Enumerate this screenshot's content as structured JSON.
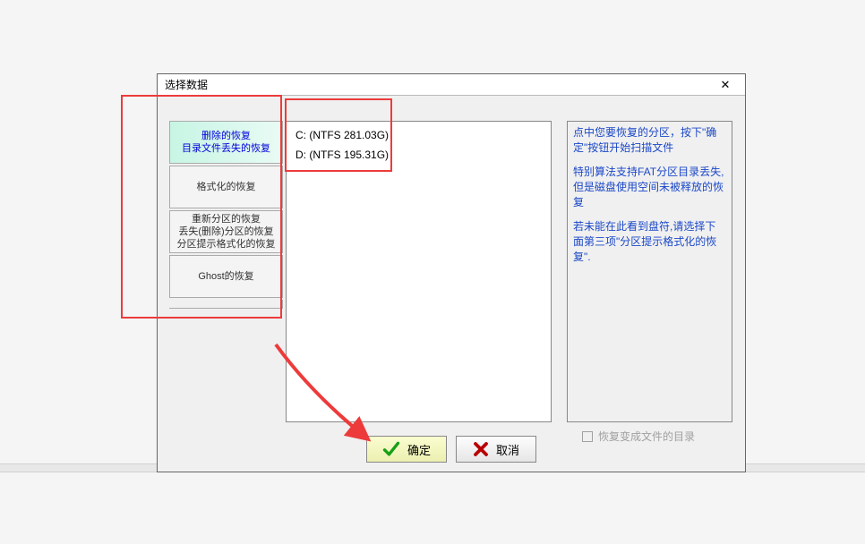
{
  "window": {
    "title": "选择数据"
  },
  "options": {
    "o1_line1": "删除的恢复",
    "o1_line2": "目录文件丢失的恢复",
    "o2": "格式化的恢复",
    "o3_line1": "重新分区的恢复",
    "o3_line2": "丢失(删除)分区的恢复",
    "o3_line3": "分区提示格式化的恢复",
    "o4": "Ghost的恢复"
  },
  "drives": [
    "C: (NTFS 281.03G)",
    "D: (NTFS 195.31G)"
  ],
  "hint": {
    "p1": "点中您要恢复的分区，按下\"确定\"按钮开始扫描文件",
    "p2": "特别算法支持FAT分区目录丢失,但是磁盘使用空间未被释放的恢复",
    "p3": "若未能在此看到盘符,请选择下面第三项\"分区提示格式化的恢复\"."
  },
  "checkbox_label": "恢复变成文件的目录",
  "buttons": {
    "ok": "确定",
    "cancel": "取消"
  }
}
